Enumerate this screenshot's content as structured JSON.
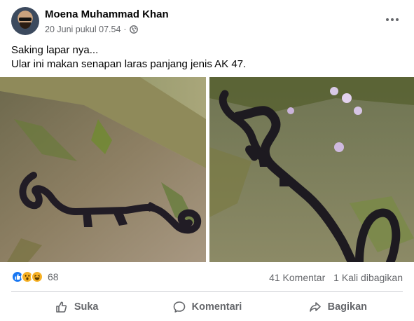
{
  "post": {
    "author": "Moena Muhammad Khan",
    "timestamp": "20 Juni pukul 07.54",
    "separator": "·",
    "privacy_icon": "globe-icon",
    "more_icon": "more-options-icon",
    "text_line1": "Saking lapar nya...",
    "text_line2": "Ular ini makan senapan laras panjang jenis AK 47."
  },
  "reactions": {
    "icons": [
      "like-icon",
      "wow-icon",
      "haha-icon"
    ],
    "count": "68",
    "comments": "41 Komentar",
    "shares": "1 Kali dibagikan"
  },
  "actions": {
    "like": "Suka",
    "comment": "Komentari",
    "share": "Bagikan"
  },
  "colors": {
    "brand": "#1877f2",
    "secondary_text": "#65676b",
    "divider": "#ced0d4"
  }
}
